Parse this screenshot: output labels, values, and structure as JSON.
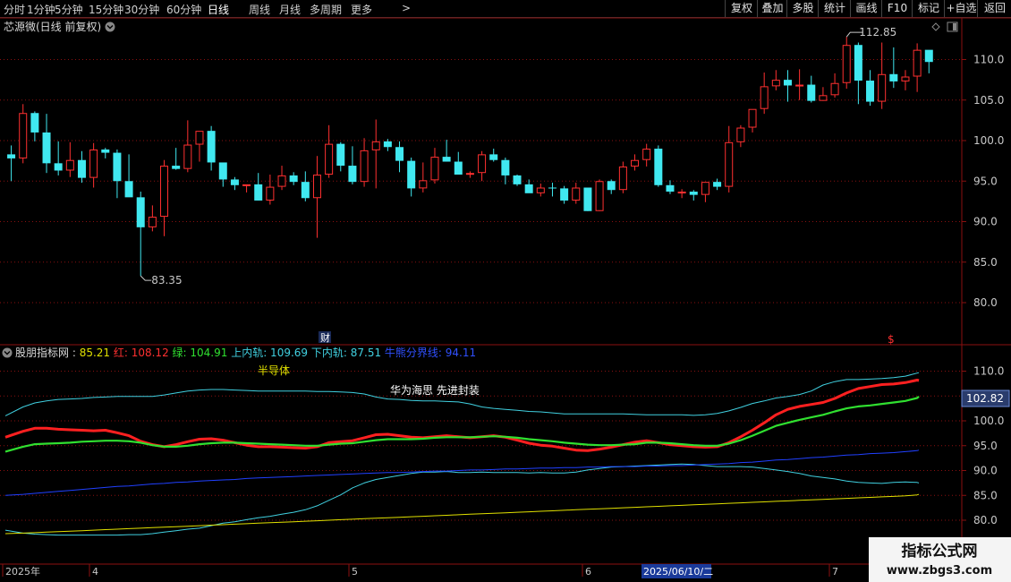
{
  "toolbar": {
    "timeframes": [
      "分时",
      "1分钟",
      "5分钟",
      "15分钟",
      "30分钟",
      "60分钟",
      "日线",
      "周线",
      "月线",
      "多周期",
      "更多"
    ],
    "more_arrow": ">",
    "right_buttons": [
      "复权",
      "叠加",
      "多股",
      "统计",
      "画线",
      "F10",
      "标记",
      "+自选",
      "返回"
    ]
  },
  "main_chart": {
    "title": "芯源微(日线 前复权)",
    "high_label": "112.85",
    "low_label": "83.35",
    "event_marker": "财",
    "s_marker": "$",
    "y_ticks": [
      "110.0",
      "105.0",
      "100.0",
      "95.0",
      "90.0",
      "85.0",
      "80.0"
    ]
  },
  "indicator": {
    "name": "股朋指标网",
    "values": [
      {
        "label": "",
        "value": "85.21",
        "color": "#e0e000"
      },
      {
        "label": "红",
        "value": "108.12",
        "color": "#ff3030"
      },
      {
        "label": "绿",
        "value": "104.91",
        "color": "#30e030"
      },
      {
        "label": "上内轨",
        "value": "109.69",
        "color": "#40d0e0"
      },
      {
        "label": "下内轨",
        "value": "87.51",
        "color": "#40d0e0"
      },
      {
        "label": "牛熊分界线",
        "value": "94.11",
        "color": "#3050ff"
      }
    ],
    "annotation1": "半导体",
    "annotation2": "华为海思 先进封装",
    "current_value": "102.82",
    "y_ticks": [
      "110.0",
      "105.0",
      "100.0",
      "95.0",
      "90.0",
      "85.0",
      "80.0"
    ]
  },
  "x_axis": {
    "labels": [
      "2025年",
      "4",
      "5",
      "6",
      "2025/06/10/二",
      "7"
    ]
  },
  "watermark": {
    "line1": "指标公式网",
    "line2": "www.zbgs3.com"
  },
  "colors": {
    "up": "#ff3030",
    "down": "#40e8f0",
    "grid": "#8b1010",
    "red_line": "#ff2020",
    "green_line": "#30e030",
    "upper_band": "#40d0e0",
    "lower_band": "#40d0e0",
    "bull_bear": "#2040ff",
    "yellow_line": "#e0e000"
  },
  "chart_data": [
    {
      "type": "candlestick",
      "title": "芯源微(日线 前复权)",
      "ylim": [
        77,
        115
      ],
      "candles": [
        [
          98.3,
          99.4,
          95.0,
          97.8
        ],
        [
          97.8,
          104.5,
          97.2,
          103.4
        ],
        [
          103.4,
          103.6,
          99.9,
          101.0
        ],
        [
          101.0,
          103.3,
          96.0,
          97.2
        ],
        [
          97.2,
          99.9,
          95.7,
          96.3
        ],
        [
          96.3,
          99.8,
          95.5,
          97.6
        ],
        [
          97.6,
          98.7,
          94.8,
          95.4
        ],
        [
          95.4,
          99.7,
          94.2,
          98.9
        ],
        [
          98.9,
          99.1,
          97.8,
          98.5
        ],
        [
          98.5,
          98.9,
          92.9,
          95.0
        ],
        [
          95.0,
          98.3,
          94.2,
          93.0
        ],
        [
          93.0,
          93.7,
          83.3,
          89.3
        ],
        [
          89.3,
          92.0,
          88.8,
          90.6
        ],
        [
          90.6,
          97.6,
          88.2,
          96.9
        ],
        [
          96.9,
          99.1,
          96.4,
          96.5
        ],
        [
          96.5,
          102.5,
          96.1,
          99.5
        ],
        [
          99.5,
          100.9,
          97.4,
          101.2
        ],
        [
          101.2,
          101.8,
          96.3,
          97.3
        ],
        [
          97.3,
          96.9,
          94.3,
          95.2
        ],
        [
          95.2,
          95.5,
          93.9,
          94.5
        ],
        [
          94.5,
          94.5,
          93.6,
          94.6
        ],
        [
          94.6,
          96.0,
          92.6,
          92.6
        ],
        [
          92.6,
          95.8,
          92.1,
          94.3
        ],
        [
          94.3,
          96.9,
          93.9,
          95.7
        ],
        [
          95.7,
          96.1,
          94.5,
          94.9
        ],
        [
          94.9,
          96.2,
          92.5,
          92.9
        ],
        [
          92.9,
          98.1,
          88.0,
          95.8
        ],
        [
          95.8,
          101.9,
          95.4,
          99.6
        ],
        [
          99.6,
          99.8,
          96.2,
          96.9
        ],
        [
          96.9,
          99.3,
          94.6,
          94.9
        ],
        [
          94.9,
          100.3,
          94.3,
          98.8
        ],
        [
          98.8,
          102.6,
          94.1,
          99.9
        ],
        [
          99.9,
          100.2,
          98.7,
          99.2
        ],
        [
          99.2,
          99.9,
          96.1,
          97.5
        ],
        [
          97.5,
          97.9,
          93.1,
          94.1
        ],
        [
          94.1,
          97.3,
          93.6,
          95.1
        ],
        [
          95.1,
          99.1,
          94.7,
          98.0
        ],
        [
          98.0,
          100.1,
          97.4,
          97.4
        ],
        [
          97.4,
          98.6,
          95.8,
          95.8
        ],
        [
          95.8,
          96.2,
          95.4,
          96.0
        ],
        [
          96.0,
          98.7,
          95.0,
          98.3
        ],
        [
          98.3,
          99.0,
          97.4,
          97.6
        ],
        [
          97.6,
          97.9,
          94.6,
          95.7
        ],
        [
          95.7,
          95.8,
          94.4,
          94.6
        ],
        [
          94.6,
          95.2,
          93.6,
          93.5
        ],
        [
          93.5,
          94.7,
          93.1,
          94.2
        ],
        [
          94.2,
          94.8,
          93.1,
          94.1
        ],
        [
          94.1,
          94.4,
          92.2,
          92.6
        ],
        [
          92.6,
          94.8,
          92.2,
          94.2
        ],
        [
          94.2,
          93.5,
          91.3,
          91.3
        ],
        [
          91.3,
          95.2,
          91.3,
          95.0
        ],
        [
          95.0,
          95.2,
          93.4,
          93.9
        ],
        [
          93.9,
          97.4,
          93.5,
          96.8
        ],
        [
          96.8,
          98.3,
          96.3,
          97.6
        ],
        [
          97.6,
          99.6,
          96.8,
          99.0
        ],
        [
          99.0,
          99.4,
          94.3,
          94.5
        ],
        [
          94.5,
          95.1,
          93.4,
          93.7
        ],
        [
          93.7,
          94.0,
          92.9,
          93.7
        ],
        [
          93.7,
          93.9,
          92.6,
          93.3
        ],
        [
          93.3,
          94.8,
          92.4,
          94.9
        ],
        [
          94.9,
          95.3,
          93.9,
          94.3
        ],
        [
          94.3,
          101.8,
          93.6,
          99.8
        ],
        [
          99.8,
          101.9,
          99.2,
          101.6
        ],
        [
          101.6,
          103.6,
          101.0,
          103.9
        ],
        [
          103.9,
          108.4,
          103.3,
          106.7
        ],
        [
          106.7,
          108.7,
          106.2,
          107.5
        ],
        [
          107.5,
          108.7,
          104.8,
          106.8
        ],
        [
          106.8,
          108.8,
          105.0,
          106.9
        ],
        [
          106.9,
          108.0,
          104.7,
          104.9
        ],
        [
          104.9,
          106.6,
          104.9,
          105.6
        ],
        [
          105.6,
          108.3,
          105.3,
          107.1
        ],
        [
          107.1,
          112.8,
          106.4,
          111.8
        ],
        [
          111.8,
          112.1,
          104.5,
          107.4
        ],
        [
          107.4,
          108.7,
          104.3,
          104.8
        ],
        [
          104.8,
          112.1,
          103.9,
          108.2
        ],
        [
          108.2,
          111.5,
          106.5,
          107.3
        ],
        [
          107.3,
          108.7,
          106.2,
          107.9
        ],
        [
          107.9,
          112.0,
          106.0,
          111.2
        ],
        [
          111.2,
          111.1,
          108.3,
          109.7
        ]
      ]
    },
    {
      "type": "line",
      "title": "股朋指标网",
      "ylim": [
        77,
        114
      ],
      "series": [
        {
          "name": "红",
          "color": "#ff2020",
          "values": [
            96.7,
            97.9,
            98.5,
            98.5,
            98.3,
            98.2,
            98.1,
            98.0,
            98.1,
            97.6,
            97.0,
            95.9,
            95.2,
            94.8,
            95.2,
            95.8,
            96.3,
            96.4,
            96.1,
            95.6,
            95.1,
            94.8,
            94.8,
            94.7,
            94.6,
            94.5,
            94.8,
            95.6,
            95.8,
            96.0,
            96.6,
            97.2,
            97.3,
            97.0,
            96.7,
            96.6,
            96.8,
            97.0,
            96.8,
            96.6,
            96.8,
            97.0,
            96.7,
            96.1,
            95.5,
            95.1,
            94.9,
            94.5,
            94.1,
            94.0,
            94.3,
            94.7,
            95.2,
            95.7,
            96.0,
            95.6,
            95.2,
            95.0,
            94.8,
            94.7,
            94.8,
            95.6,
            96.8,
            98.1,
            99.6,
            101.2,
            102.3,
            102.9,
            103.3,
            103.7,
            104.5,
            105.6,
            106.5,
            106.9,
            107.3,
            107.4,
            107.7,
            108.2,
            108.1
          ]
        },
        {
          "name": "绿",
          "color": "#30e030",
          "values": [
            93.8,
            94.8,
            95.3,
            95.4,
            95.5,
            95.6,
            95.8,
            95.9,
            96.0,
            96.0,
            95.9,
            95.6,
            95.1,
            94.8,
            94.8,
            95.0,
            95.3,
            95.5,
            95.6,
            95.6,
            95.5,
            95.4,
            95.3,
            95.2,
            95.1,
            95.0,
            95.0,
            95.2,
            95.4,
            95.5,
            95.8,
            96.1,
            96.3,
            96.3,
            96.3,
            96.4,
            96.6,
            96.7,
            96.7,
            96.7,
            96.8,
            96.9,
            96.8,
            96.6,
            96.3,
            96.1,
            95.9,
            95.6,
            95.4,
            95.2,
            95.1,
            95.1,
            95.2,
            95.3,
            95.6,
            95.6,
            95.5,
            95.3,
            95.1,
            95.0,
            95.0,
            95.4,
            96.1,
            97.0,
            98.0,
            99.0,
            99.6,
            100.2,
            100.7,
            101.2,
            101.9,
            102.5,
            102.9,
            103.1,
            103.4,
            103.7,
            104.0,
            104.6,
            104.9
          ]
        },
        {
          "name": "上内轨",
          "color": "#40d0e0",
          "values": [
            101.0,
            102.8,
            103.6,
            104.0,
            104.3,
            104.4,
            104.5,
            104.7,
            104.8,
            104.9,
            104.9,
            104.9,
            104.9,
            105.2,
            105.6,
            106.0,
            106.2,
            106.3,
            106.3,
            106.2,
            106.1,
            106.0,
            106.0,
            106.0,
            106.0,
            106.0,
            105.9,
            105.9,
            105.8,
            105.7,
            105.4,
            104.8,
            104.4,
            104.3,
            104.1,
            104.0,
            104.0,
            103.9,
            103.8,
            103.4,
            102.8,
            102.5,
            102.3,
            102.1,
            101.9,
            101.8,
            101.6,
            101.4,
            101.4,
            101.4,
            101.4,
            101.4,
            101.4,
            101.3,
            101.2,
            101.2,
            101.2,
            101.2,
            101.1,
            101.2,
            101.5,
            102.0,
            102.7,
            103.5,
            104.0,
            104.6,
            104.9,
            105.3,
            106.0,
            107.2,
            107.9,
            108.3,
            108.3,
            108.4,
            108.5,
            108.7,
            109.0,
            109.6,
            109.7
          ]
        },
        {
          "name": "下内轨",
          "color": "#40d0e0",
          "values": [
            78.0,
            77.4,
            77.2,
            77.1,
            77.0,
            77.0,
            77.0,
            77.0,
            77.0,
            77.0,
            77.1,
            77.1,
            77.3,
            77.6,
            77.9,
            78.2,
            78.4,
            78.9,
            79.4,
            79.7,
            80.1,
            80.5,
            80.8,
            81.2,
            81.6,
            82.1,
            82.9,
            84.0,
            85.1,
            86.5,
            87.5,
            88.2,
            88.6,
            89.0,
            89.4,
            89.7,
            89.7,
            89.8,
            89.6,
            89.6,
            89.7,
            89.6,
            89.6,
            89.6,
            89.5,
            89.6,
            89.5,
            89.5,
            89.7,
            90.1,
            90.4,
            90.7,
            90.8,
            90.9,
            91.0,
            91.1,
            91.2,
            91.3,
            91.2,
            91.0,
            90.8,
            90.8,
            90.8,
            90.7,
            90.4,
            90.1,
            89.8,
            89.4,
            88.9,
            88.6,
            88.3,
            87.9,
            87.6,
            87.5,
            87.4,
            87.6,
            87.7,
            87.6,
            87.5
          ]
        },
        {
          "name": "牛熊分界线",
          "color": "#2040ff",
          "values": [
            85.0,
            85.2,
            85.4,
            85.6,
            85.8,
            86.0,
            86.2,
            86.4,
            86.6,
            86.8,
            86.9,
            87.1,
            87.3,
            87.4,
            87.6,
            87.7,
            87.9,
            88.0,
            88.1,
            88.2,
            88.4,
            88.5,
            88.6,
            88.7,
            88.8,
            88.9,
            89.0,
            89.1,
            89.2,
            89.3,
            89.4,
            89.5,
            89.6,
            89.6,
            89.7,
            89.8,
            89.9,
            89.9,
            90.0,
            90.1,
            90.1,
            90.2,
            90.3,
            90.3,
            90.4,
            90.5,
            90.5,
            90.6,
            90.6,
            90.7,
            90.7,
            90.8,
            90.8,
            90.8,
            90.9,
            90.9,
            91.0,
            91.0,
            91.1,
            91.2,
            91.3,
            91.4,
            91.6,
            91.7,
            91.9,
            92.1,
            92.2,
            92.4,
            92.6,
            92.7,
            92.9,
            93.1,
            93.2,
            93.4,
            93.5,
            93.6,
            93.8,
            94.0,
            94.1
          ]
        },
        {
          "name": "yellow",
          "color": "#e0e000",
          "values": [
            77.3,
            77.4,
            77.5,
            77.6,
            77.7,
            77.8,
            77.9,
            78.0,
            78.1,
            78.2,
            78.3,
            78.4,
            78.5,
            78.6,
            78.7,
            78.8,
            78.9,
            79.0,
            79.1,
            79.2,
            79.3,
            79.4,
            79.5,
            79.6,
            79.7,
            79.8,
            79.9,
            80.0,
            80.1,
            80.2,
            80.3,
            80.4,
            80.5,
            80.6,
            80.7,
            80.8,
            80.9,
            81.0,
            81.1,
            81.2,
            81.3,
            81.4,
            81.5,
            81.6,
            81.7,
            81.8,
            81.9,
            82.0,
            82.1,
            82.2,
            82.3,
            82.4,
            82.5,
            82.6,
            82.7,
            82.8,
            82.9,
            83.0,
            83.1,
            83.2,
            83.3,
            83.4,
            83.5,
            83.6,
            83.7,
            83.8,
            83.9,
            84.0,
            84.1,
            84.2,
            84.3,
            84.4,
            84.5,
            84.6,
            84.7,
            84.8,
            84.9,
            85.1,
            85.2
          ]
        }
      ]
    }
  ]
}
